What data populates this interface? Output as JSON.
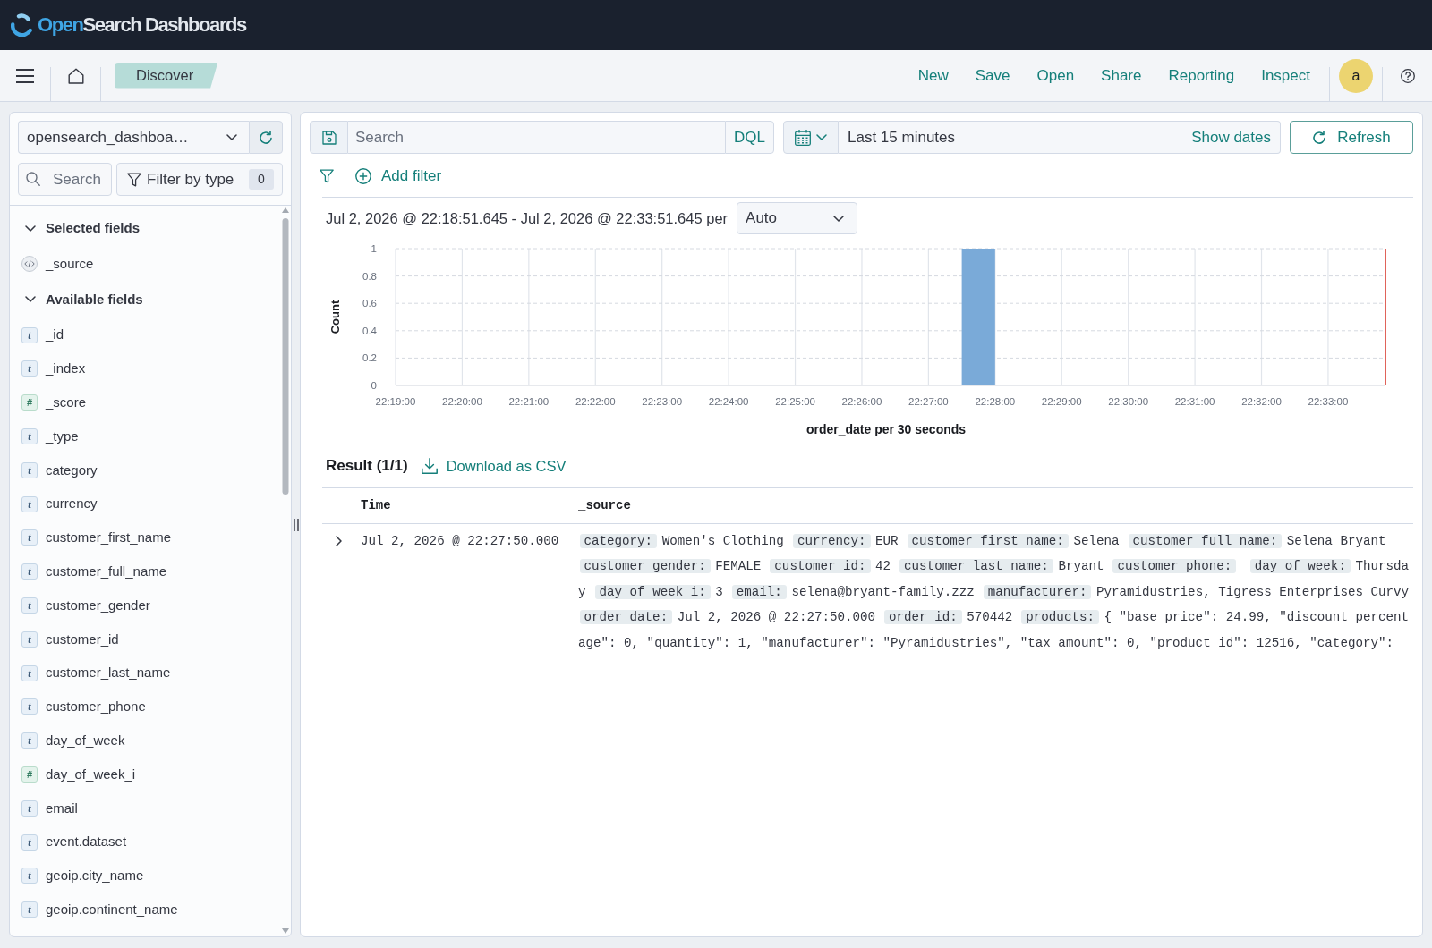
{
  "header": {
    "logo": {
      "accent": "Open",
      "rest": "Search Dashboards"
    }
  },
  "nav": {
    "breadcrumb": "Discover",
    "links": [
      "New",
      "Save",
      "Open",
      "Share",
      "Reporting",
      "Inspect"
    ],
    "avatar": "a"
  },
  "sidebar": {
    "index_pattern": "opensearch_dashboa…",
    "search": {
      "placeholder": "Search"
    },
    "filter_by_type": {
      "label": "Filter by type",
      "count": "0"
    },
    "sections": [
      {
        "title": "Selected fields",
        "expanded": true,
        "fields": [
          {
            "name": "_source",
            "kind": "source"
          }
        ]
      },
      {
        "title": "Available fields",
        "expanded": true,
        "fields": [
          {
            "name": "_id",
            "kind": "string",
            "icon": "t"
          },
          {
            "name": "_index",
            "kind": "string",
            "icon": "t"
          },
          {
            "name": "_score",
            "kind": "number",
            "icon": "#"
          },
          {
            "name": "_type",
            "kind": "string",
            "icon": "t"
          },
          {
            "name": "category",
            "kind": "string",
            "icon": "t"
          },
          {
            "name": "currency",
            "kind": "string",
            "icon": "t"
          },
          {
            "name": "customer_first_name",
            "kind": "string",
            "icon": "t"
          },
          {
            "name": "customer_full_name",
            "kind": "string",
            "icon": "t"
          },
          {
            "name": "customer_gender",
            "kind": "string",
            "icon": "t"
          },
          {
            "name": "customer_id",
            "kind": "string",
            "icon": "t"
          },
          {
            "name": "customer_last_name",
            "kind": "string",
            "icon": "t"
          },
          {
            "name": "customer_phone",
            "kind": "string",
            "icon": "t"
          },
          {
            "name": "day_of_week",
            "kind": "string",
            "icon": "t"
          },
          {
            "name": "day_of_week_i",
            "kind": "number",
            "icon": "#"
          },
          {
            "name": "email",
            "kind": "string",
            "icon": "t"
          },
          {
            "name": "event.dataset",
            "kind": "string",
            "icon": "t"
          },
          {
            "name": "geoip.city_name",
            "kind": "string",
            "icon": "t"
          },
          {
            "name": "geoip.continent_name",
            "kind": "string",
            "icon": "t"
          }
        ]
      }
    ]
  },
  "query_bar": {
    "search": {
      "placeholder": "Search"
    },
    "language": "DQL",
    "time_range": "Last 15 minutes",
    "show_dates": "Show dates",
    "refresh": "Refresh"
  },
  "filter_bar": {
    "add_filter": "Add filter"
  },
  "histogram": {
    "range": "Jul 2, 2026 @ 22:18:51.645 - Jul 2, 2026 @ 22:33:51.645 per",
    "interval": "Auto",
    "chart_data": {
      "type": "bar",
      "xlabel": "order_date per 30 seconds",
      "ylabel": "Count",
      "x": [
        80865
      ],
      "values": [
        1
      ],
      "xlim": [
        80340,
        81231.645
      ],
      "ylim": [
        0,
        1
      ],
      "grid": true,
      "xticks": [
        {
          "value": 80340,
          "label": "22:19:00"
        },
        {
          "value": 80400,
          "label": "22:20:00"
        },
        {
          "value": 80460,
          "label": "22:21:00"
        },
        {
          "value": 80520,
          "label": "22:22:00"
        },
        {
          "value": 80580,
          "label": "22:23:00"
        },
        {
          "value": 80640,
          "label": "22:24:00"
        },
        {
          "value": 80700,
          "label": "22:25:00"
        },
        {
          "value": 80760,
          "label": "22:26:00"
        },
        {
          "value": 80820,
          "label": "22:27:00"
        },
        {
          "value": 80880,
          "label": "22:28:00"
        },
        {
          "value": 80940,
          "label": "22:29:00"
        },
        {
          "value": 81000,
          "label": "22:30:00"
        },
        {
          "value": 81060,
          "label": "22:31:00"
        },
        {
          "value": 81120,
          "label": "22:32:00"
        },
        {
          "value": 81180,
          "label": "22:33:00"
        }
      ],
      "yticks": [
        0,
        0.2,
        0.4,
        0.6,
        0.8,
        1
      ]
    }
  },
  "results": {
    "title": "Result (1/1)",
    "download": "Download as CSV",
    "columns": [
      "Time",
      "_source"
    ],
    "rows": [
      {
        "expanded": false,
        "time": "Jul 2, 2026 @ 22:27:50.000",
        "source": [
          {
            "key": "category:",
            "value": "Women's Clothing"
          },
          {
            "key": "currency:",
            "value": "EUR"
          },
          {
            "key": "customer_first_name:",
            "value": "Selena"
          },
          {
            "key": "customer_full_name:",
            "value": "Selena Bryant"
          },
          {
            "key": "customer_gender:",
            "value": "FEMALE"
          },
          {
            "key": "customer_id:",
            "value": "42"
          },
          {
            "key": "customer_last_name:",
            "value": "Bryant"
          },
          {
            "key": "customer_phone:"
          },
          {
            "key": "day_of_week:",
            "value": "Thursday"
          },
          {
            "key": "day_of_week_i:",
            "value": "3"
          },
          {
            "key": "email:",
            "value": "selena@bryant-family.zzz"
          },
          {
            "key": "manufacturer:",
            "value": "Pyramidustries, Tigress Enterprises Curvy"
          },
          {
            "key": "order_date:",
            "value": "Jul 2, 2026 @ 22:27:50.000"
          },
          {
            "key": "order_id:",
            "value": "570442"
          },
          {
            "key": "products:",
            "value": "{ \"base_price\": 24.99, \"discount_percentage\": 0, \"quantity\": 1, \"manufacturer\": \"Pyramidustries\", \"tax_amount\": 0, \"product_id\": 12516, \"category\":"
          }
        ]
      }
    ]
  }
}
